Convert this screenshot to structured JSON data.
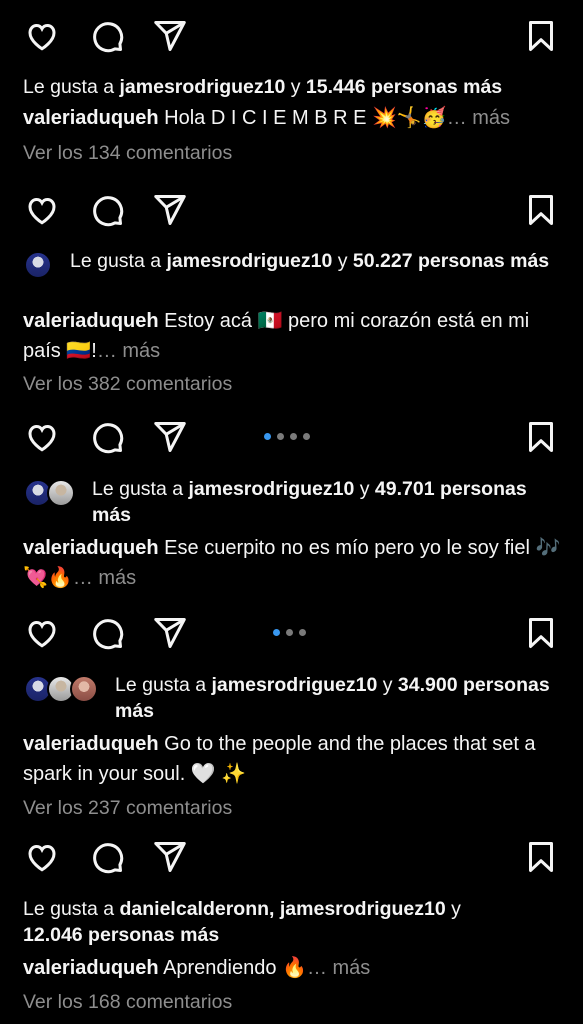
{
  "posts": [
    {
      "likes_prefix": "Le gusta a ",
      "liked_by": "jamesrodriguez10",
      "likes_join": " y ",
      "likes_count": "15.446 personas más",
      "username": "valeriaduqueh",
      "caption": "Hola D I C I E M B R E 💥🤸🥳",
      "more": "… más",
      "comments": "Ver los 134 comentarios"
    },
    {
      "likes_prefix": "Le gusta a ",
      "liked_by": "jamesrodriguez10",
      "likes_join": " y ",
      "likes_count": "50.227 personas más",
      "username": "valeriaduqueh",
      "caption": "Estoy acá 🇲🇽 pero mi corazón está en mi país 🇨🇴!",
      "more": "… más",
      "comments": "Ver los 382 comentarios"
    },
    {
      "likes_prefix": "Le gusta a ",
      "liked_by": "jamesrodriguez10",
      "likes_join": " y ",
      "likes_count": "49.701 personas más",
      "username": "valeriaduqueh",
      "caption": "Ese cuerpito no es mío pero yo le soy fiel 🎶💘🔥",
      "more": "… más"
    },
    {
      "likes_prefix": "Le gusta a ",
      "liked_by": "jamesrodriguez10",
      "likes_join": " y ",
      "likes_count": "34.900 personas más",
      "username": "valeriaduqueh",
      "caption": "Go to the people and the places that set a spark in your soul. 🤍 ✨",
      "comments": "Ver los 237 comentarios"
    },
    {
      "likes_prefix": "Le gusta a ",
      "liked_by": "danielcalderonn, jamesrodriguez10",
      "likes_join": " y ",
      "likes_count": "12.046 personas más",
      "username": "valeriaduqueh",
      "caption": "Aprendiendo 🔥",
      "more": "… más",
      "comments": "Ver los 168 comentarios"
    }
  ],
  "icons": {
    "like": "heart-outline-icon",
    "comment": "comment-bubble-icon",
    "share": "paper-plane-icon",
    "save": "bookmark-outline-icon"
  },
  "colors": {
    "background": "#000000",
    "text": "#f5f5f5",
    "muted": "#8e8e8e",
    "carousel_active": "#3897f0"
  }
}
